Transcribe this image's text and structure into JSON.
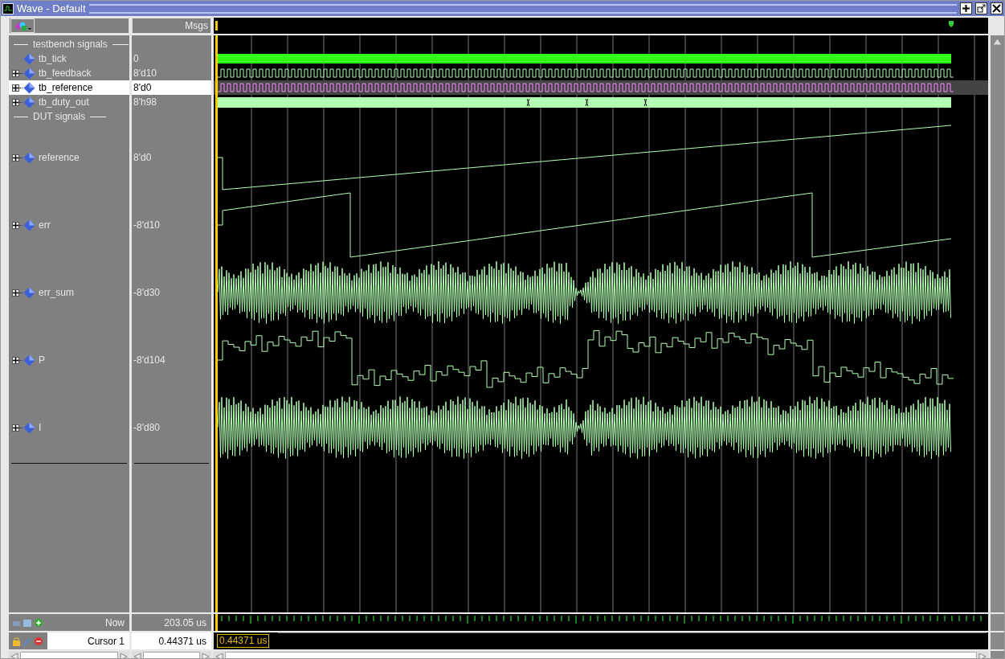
{
  "window": {
    "title": "Wave - Default"
  },
  "header": {
    "values_label": "Msgs"
  },
  "groups": [
    {
      "label": "testbench signals",
      "signals": [
        {
          "name": "tb_tick",
          "value": "0",
          "kind": "bit",
          "expandable": false,
          "selected": false
        },
        {
          "name": "tb_feedback",
          "value": "8'd10",
          "kind": "toggle",
          "expandable": true,
          "selected": false
        },
        {
          "name": "tb_reference",
          "value": "8'd0",
          "kind": "toggle",
          "expandable": true,
          "selected": true
        },
        {
          "name": "tb_duty_out",
          "value": "8'h98",
          "kind": "bus",
          "expandable": true,
          "selected": false
        }
      ]
    },
    {
      "label": "DUT signals",
      "signals": [
        {
          "name": "reference",
          "value": "8'd0",
          "kind": "ramp",
          "expandable": true,
          "selected": false
        },
        {
          "name": "err",
          "value": "-8'd10",
          "kind": "sawtooth",
          "expandable": true,
          "selected": false
        },
        {
          "name": "err_sum",
          "value": "-8'd30",
          "kind": "dense",
          "expandable": true,
          "selected": false
        },
        {
          "name": "P",
          "value": "-8'd104",
          "kind": "steps",
          "expandable": true,
          "selected": false
        },
        {
          "name": "I",
          "value": "-8'd80",
          "kind": "dense",
          "expandable": true,
          "selected": false
        }
      ]
    }
  ],
  "footer": {
    "now_label": "Now",
    "now_value": "203.05 us",
    "cursor_label": "Cursor 1",
    "cursor_value": "0.44371 us",
    "cursor_tag": "0.44371 us"
  }
}
